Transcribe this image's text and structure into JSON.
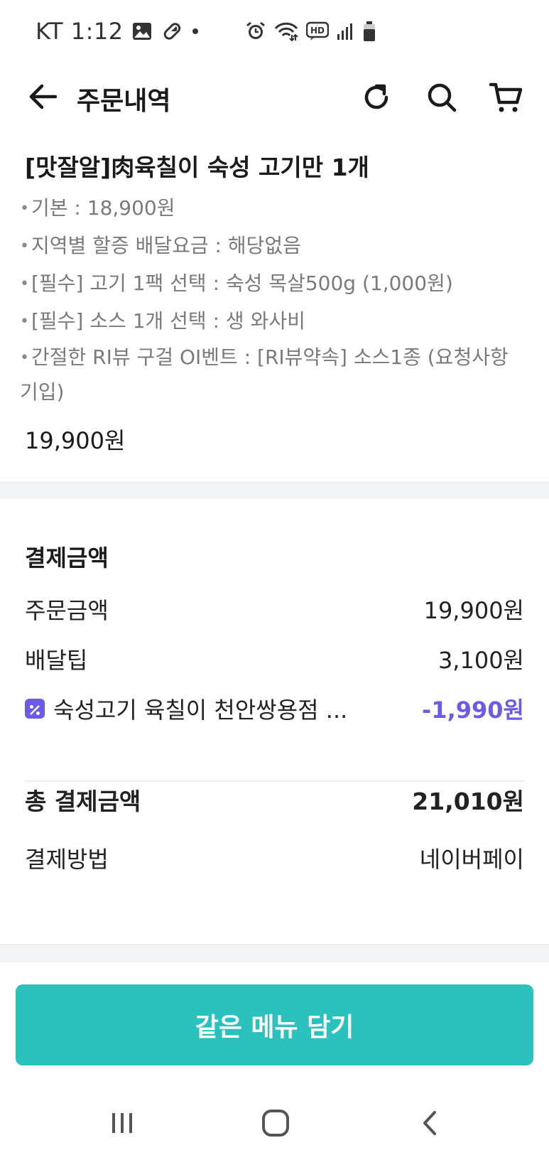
{
  "status_bar": {
    "carrier_time": "KT 1:12",
    "icons": [
      "gallery-icon",
      "pill-icon",
      "dot-icon",
      "alarm-icon",
      "wifi-icon",
      "hd-icon",
      "signal-icon",
      "battery-icon"
    ]
  },
  "header": {
    "title": "주문내역",
    "icons": [
      "back-arrow-icon",
      "refresh-icon",
      "search-icon",
      "cart-icon"
    ]
  },
  "order_item": {
    "name": "[맛잘알]肉육칠이 숙성 고기만 1개",
    "options": [
      "기본 : 18,900원",
      "지역별 할증 배달요금 : 해당없음",
      "[필수] 고기 1팩 선택 : 숙성 목살500g (1,000원)",
      "[필수] 소스 1개 선택 : 생 와사비",
      "간절한 RI뷰 구걸 OI벤트 : [RI뷰약속] 소스1종 (요청사항 기입)"
    ],
    "price": "19,900원"
  },
  "payment": {
    "section_title": "결제금액",
    "order_amount_label": "주문금액",
    "order_amount_value": "19,900원",
    "delivery_tip_label": "배달팁",
    "delivery_tip_value": "3,100원",
    "discount_label": "숙성고기 육칠이 천안쌍용점 ...",
    "discount_value": "-1,990원",
    "total_label": "총 결제금액",
    "total_value": "21,010원",
    "method_label": "결제방법",
    "method_value": "네이버페이"
  },
  "cta": {
    "label": "같은 메뉴 담기"
  },
  "nav_bar": {
    "icons": [
      "recent-apps-icon",
      "home-icon",
      "system-back-icon"
    ]
  },
  "colors": {
    "accent_teal": "#2bc2bd",
    "discount_purple": "#6b5ce7",
    "option_gray": "#7a7a7a"
  }
}
